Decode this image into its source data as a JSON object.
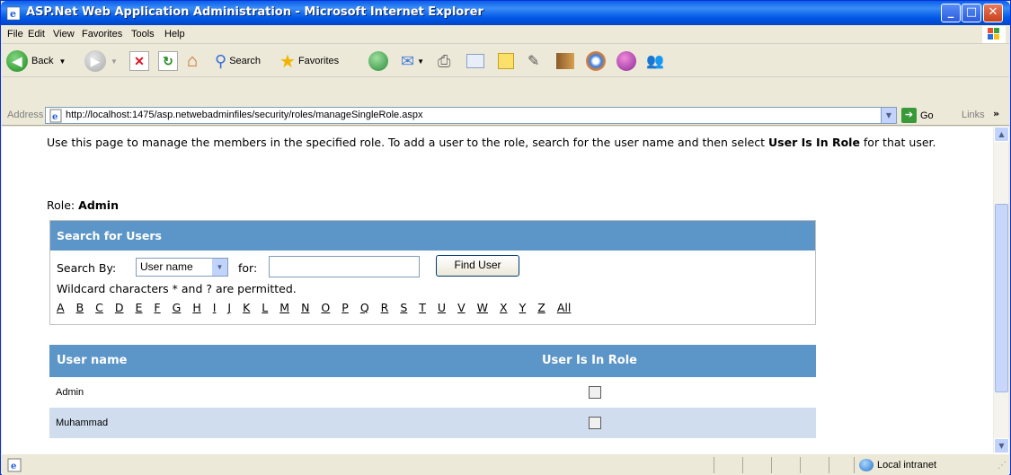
{
  "window": {
    "title": "ASP.Net Web Application Administration - Microsoft Internet Explorer"
  },
  "menubar": {
    "items": [
      "File",
      "Edit",
      "View",
      "Favorites",
      "Tools",
      "Help"
    ]
  },
  "toolbar": {
    "back_label": "Back",
    "search_label": "Search",
    "favorites_label": "Favorites"
  },
  "address": {
    "label": "Address",
    "url": "http://localhost:1475/asp.netwebadminfiles/security/roles/manageSingleRole.aspx",
    "go_label": "Go",
    "links_label": "Links"
  },
  "page": {
    "intro_part1": "Use this page to manage the members in the specified role. To add a user to the role, search for the user name and then select ",
    "intro_bold": "User Is In Role",
    "intro_part2": " for that user.",
    "role_label": "Role:",
    "role_value": "Admin"
  },
  "search_panel": {
    "title": "Search for Users",
    "search_by_label": "Search By:",
    "search_by_value": "User name",
    "for_label": "for:",
    "query_value": "",
    "find_button": "Find User",
    "wildcard_note": "Wildcard characters * and ? are permitted.",
    "letters": [
      "A",
      "B",
      "C",
      "D",
      "E",
      "F",
      "G",
      "H",
      "I",
      "J",
      "K",
      "L",
      "M",
      "N",
      "O",
      "P",
      "Q",
      "R",
      "S",
      "T",
      "U",
      "V",
      "W",
      "X",
      "Y",
      "Z",
      "All"
    ]
  },
  "users_grid": {
    "col_user": "User name",
    "col_role": "User Is In Role",
    "rows": [
      {
        "name": "Admin",
        "in_role": false
      },
      {
        "name": "Muhammad",
        "in_role": false
      }
    ]
  },
  "statusbar": {
    "zone": "Local intranet"
  },
  "colors": {
    "header_blue": "#5c95c7",
    "alt_row": "#cfddee",
    "xp_title": "#0058e6"
  }
}
